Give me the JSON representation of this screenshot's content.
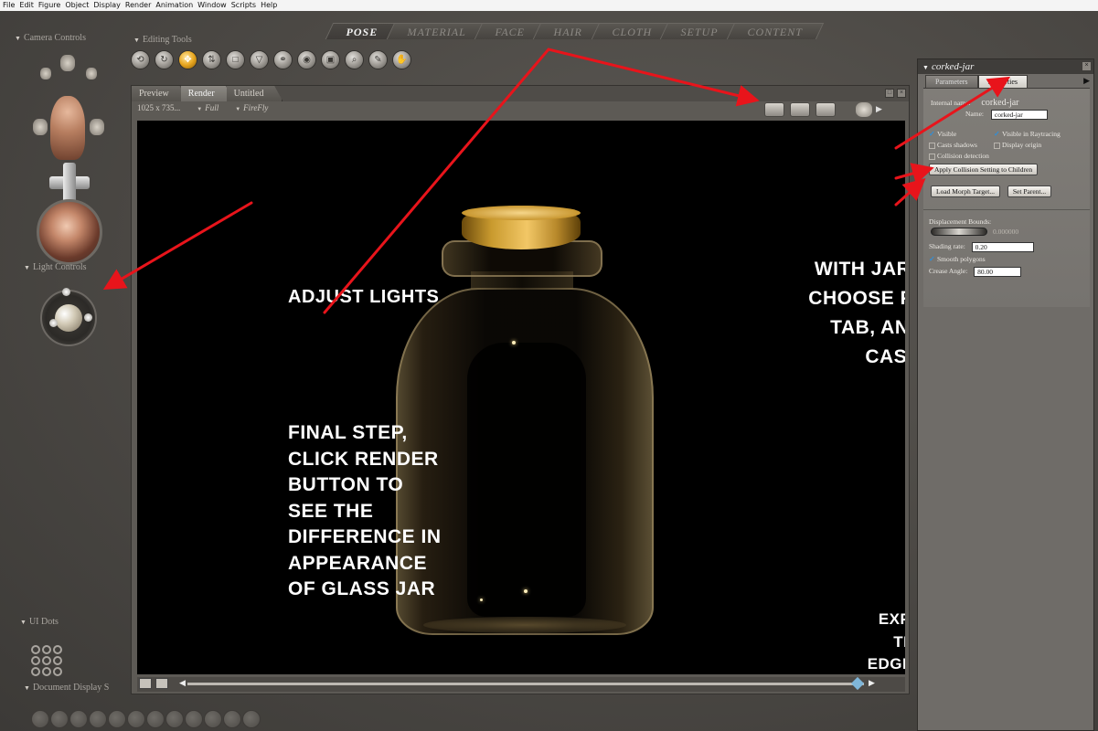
{
  "menu": [
    "File",
    "Edit",
    "Figure",
    "Object",
    "Display",
    "Render",
    "Animation",
    "Window",
    "Scripts",
    "Help"
  ],
  "room_tabs": [
    "POSE",
    "MATERIAL",
    "FACE",
    "HAIR",
    "CLOTH",
    "SETUP",
    "CONTENT"
  ],
  "active_room": "POSE",
  "left": {
    "camera_controls_label": "Camera Controls",
    "editing_tools_label": "Editing Tools",
    "light_controls_label": "Light Controls",
    "ui_dots_label": "UI Dots",
    "document_display_label": "Document Display S"
  },
  "document": {
    "tabs": [
      "Preview",
      "Render",
      "Untitled"
    ],
    "active_tab": "Render",
    "size": "1025 x 735...",
    "quality": "Full",
    "renderer": "FireFly"
  },
  "annotations": {
    "adjust_lights": "ADJUST LIGHTS",
    "final_step": "FINAL STEP,\nCLICK RENDER\nBUTTON TO\nSEE THE\nDIFFERENCE IN\nAPPEARANCE\nOF GLASS JAR",
    "with_jar": "WITH JAR SELECTED,\nCHOOSE PROPERTIES\nTAB, AND UNCHECK\nCAST SHADOWS",
    "experiment": "EXPERIMENT WITH\nTRANSPARENCY,\nEDGE AND FALLOFF\nSETTINGS AND\nTRY DIFFERENT\nLIGHT COLORS\nAND PLACEMENT"
  },
  "properties": {
    "title": "corked-jar",
    "tabs": [
      "Parameters",
      "Properties"
    ],
    "active_tab": "Properties",
    "internal_name_label": "Internal name:",
    "internal_name_value": "corked-jar",
    "name_label": "Name:",
    "name_value": "corked-jar",
    "visible_label": "Visible",
    "visible_in_raytracing_label": "Visible in Raytracing",
    "casts_shadows_label": "Casts shadows",
    "display_origin_label": "Display origin",
    "collision_detection_label": "Collision detection",
    "apply_collision_button": "Apply Collision Setting to Children",
    "load_morph_button": "Load Morph Target...",
    "set_parent_button": "Set Parent...",
    "displacement_label": "Displacement Bounds:",
    "displacement_value": "0.000000",
    "shading_rate_label": "Shading rate:",
    "shading_rate_value": "0.20",
    "smooth_polygons_label": "Smooth polygons",
    "crease_angle_label": "Crease Angle:",
    "crease_angle_value": "80.00",
    "checked": {
      "visible": true,
      "visible_in_raytracing": true,
      "casts_shadows": false,
      "display_origin": false,
      "collision_detection": false,
      "smooth_polygons": true
    }
  },
  "colors": {
    "annotation_arrow": "#e8141b",
    "accent_tool": "#e9a720",
    "canvas_bg": "#000000",
    "cork": "#d9a94a"
  }
}
